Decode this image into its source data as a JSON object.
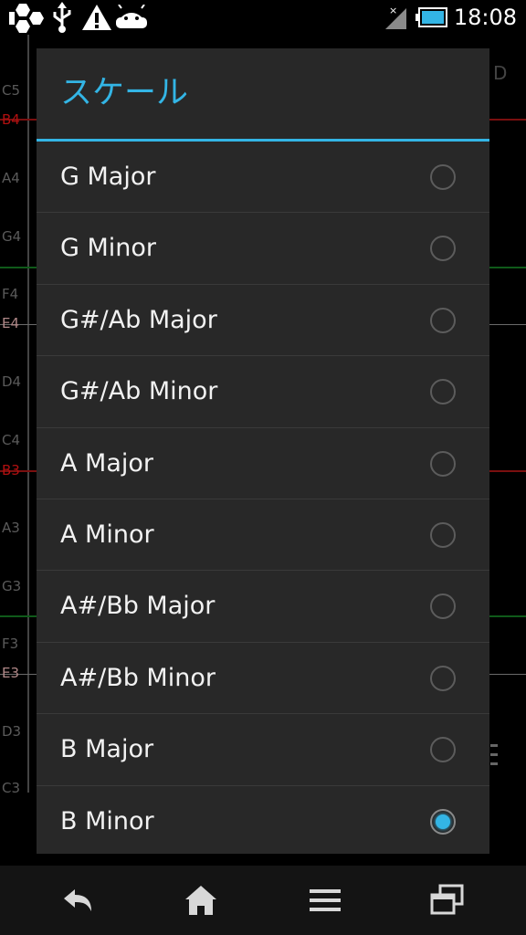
{
  "status_bar": {
    "time": "18:08",
    "icons_left": [
      "hexagon-icon",
      "usb-icon",
      "warning-icon",
      "android-icon"
    ],
    "icons_right": [
      "no-signal-icon",
      "battery-icon"
    ]
  },
  "background": {
    "note_labels": [
      "C5",
      "B4",
      "A4",
      "G4",
      "F4",
      "E4",
      "D4",
      "C4",
      "B3",
      "A3",
      "G3",
      "F3",
      "E3",
      "D3",
      "C3"
    ],
    "partial_label": "D"
  },
  "dialog": {
    "title": "スケール",
    "options": [
      {
        "label": "G Major",
        "selected": false
      },
      {
        "label": "G Minor",
        "selected": false
      },
      {
        "label": "G#/Ab Major",
        "selected": false
      },
      {
        "label": "G#/Ab Minor",
        "selected": false
      },
      {
        "label": "A Major",
        "selected": false
      },
      {
        "label": "A Minor",
        "selected": false
      },
      {
        "label": "A#/Bb Major",
        "selected": false
      },
      {
        "label": "A#/Bb Minor",
        "selected": false
      },
      {
        "label": "B Major",
        "selected": false
      },
      {
        "label": "B Minor",
        "selected": true
      }
    ]
  },
  "nav_bar": {
    "buttons": [
      "back-icon",
      "home-icon",
      "menu-icon",
      "recent-apps-icon"
    ]
  },
  "colors": {
    "accent": "#33b5e5",
    "dialog_bg": "#282828"
  }
}
